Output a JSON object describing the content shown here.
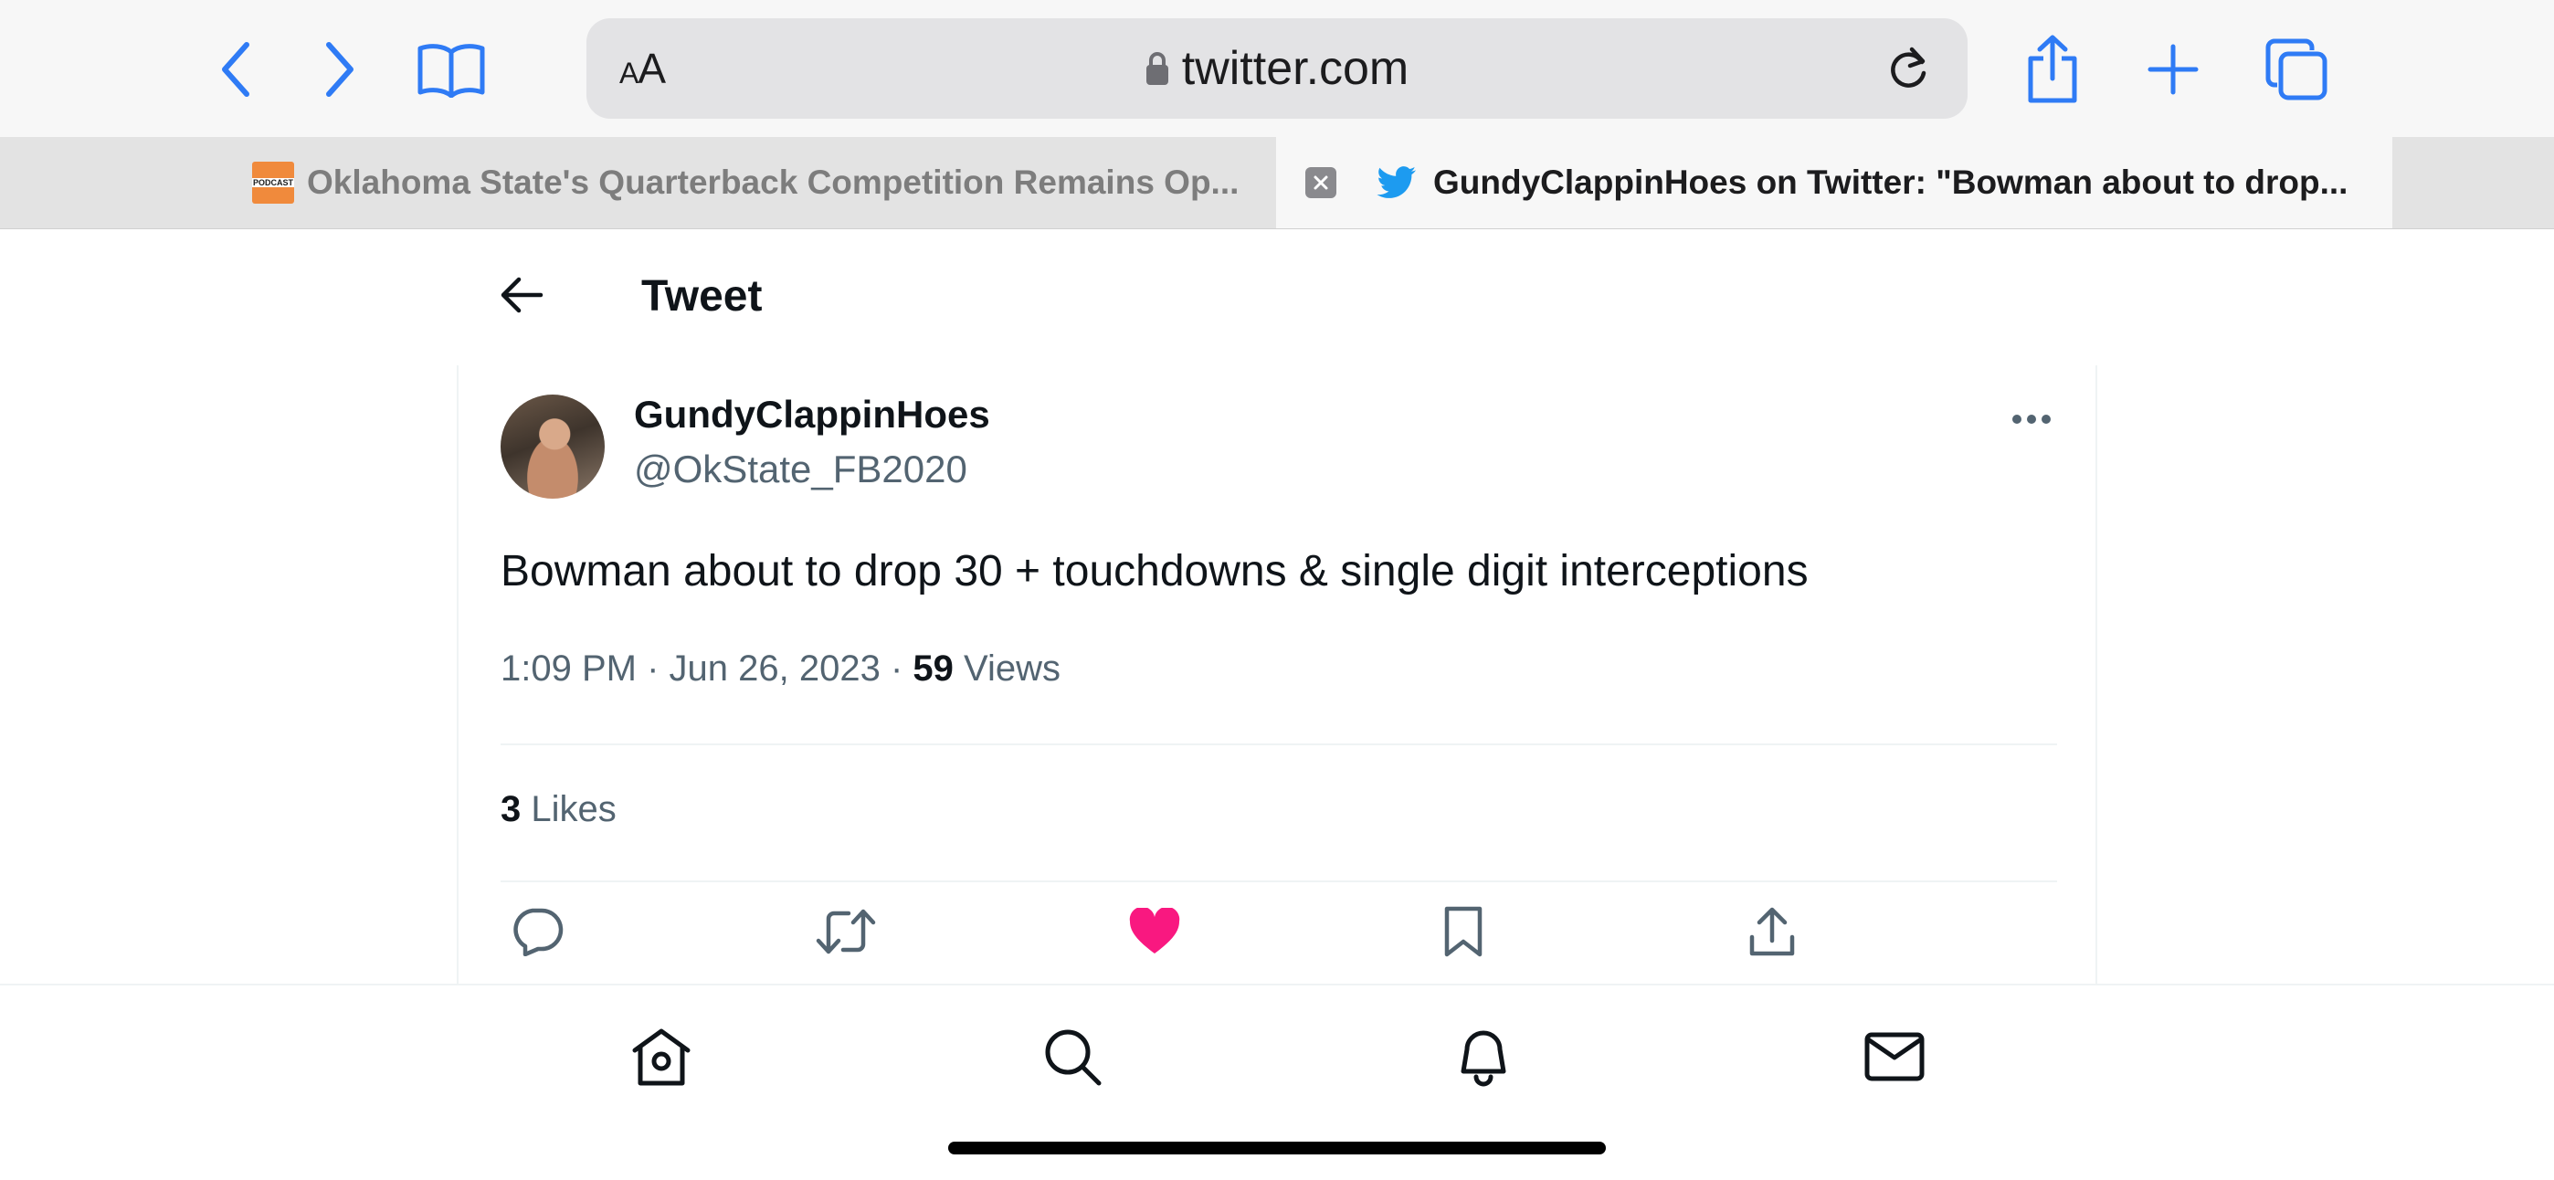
{
  "browser": {
    "text_size_label_small": "A",
    "text_size_label_large": "A",
    "url": "twitter.com",
    "accent_color": "#2f7bf5",
    "icons": [
      "back-chevron",
      "forward-chevron",
      "bookmarks",
      "lock",
      "reload",
      "share",
      "new-tab-plus",
      "tabs-overview"
    ]
  },
  "tabs": [
    {
      "title": "Oklahoma State's Quarterback Competition Remains Op...",
      "favicon": "podcast",
      "favicon_label": "PODCAST",
      "active": false
    },
    {
      "title": "GundyClappinHoes on Twitter: \"Bowman about to drop...",
      "favicon": "twitter-bird",
      "active": true
    }
  ],
  "page": {
    "title": "Tweet"
  },
  "tweet": {
    "display_name": "GundyClappinHoes",
    "handle": "@OkState_FB2020",
    "text": "Bowman about to drop 30 + touchdowns & single digit interceptions",
    "timestamp": "1:09 PM · Jun 26, 2023",
    "separator": " · ",
    "views_count": "59",
    "views_label": " Views",
    "likes_count": "3",
    "likes_label": " Likes",
    "liked": true,
    "like_color": "#f91880"
  },
  "bottom_nav": [
    "home",
    "search",
    "notifications",
    "messages"
  ]
}
